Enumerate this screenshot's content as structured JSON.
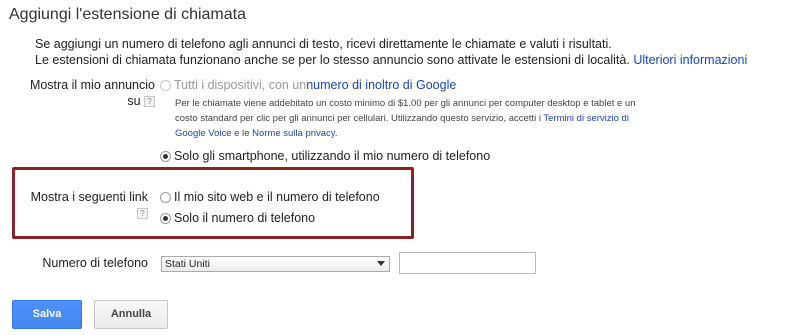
{
  "header": {
    "title": "Aggiungi l'estensione di chiamata"
  },
  "intro": {
    "line1": "Se aggiungi un numero di telefono agli annunci di testo, ricevi direttamente le chiamate e valuti i risultati.",
    "line2": "Le estensioni di chiamata funzionano anche se per lo stesso annuncio sono attivate le estensioni di località.",
    "more_link": "Ulteriori informazioni"
  },
  "show_ad": {
    "label_line1": "Mostra il mio annuncio",
    "label_line2": "su",
    "help": "?",
    "option_all_prefix": "Tutti i dispositivi, con un ",
    "option_all_link": "numero di inoltro di Google",
    "note_part1": "Per le chiamate viene addebitato un costo minimo di $1.00 per gli annunci per computer desktop e tablet e un costo standard per clic per gli annunci per cellulari. Utilizzando questo servizio, accetti i ",
    "note_terms_link": "Termini di servizio di Google Voice",
    "note_part2": " e le ",
    "note_privacy_link": "Norme sulla privacy",
    "note_part3": ".",
    "option_smartphone": "Solo gli smartphone, utilizzando il mio numero di telefono",
    "selected": "smartphone"
  },
  "show_links": {
    "label": "Mostra i seguenti link",
    "help": "?",
    "option_site_phone": "Il mio sito web e il numero di telefono",
    "option_phone_only": "Solo il numero di telefono",
    "selected": "phone_only",
    "highlight_color": "#8b2222"
  },
  "phone": {
    "label": "Numero di telefono",
    "country_selected": "Stati Uniti",
    "number_value": ""
  },
  "actions": {
    "save": "Salva",
    "cancel": "Annulla",
    "primary_color": "#4d90fe"
  }
}
